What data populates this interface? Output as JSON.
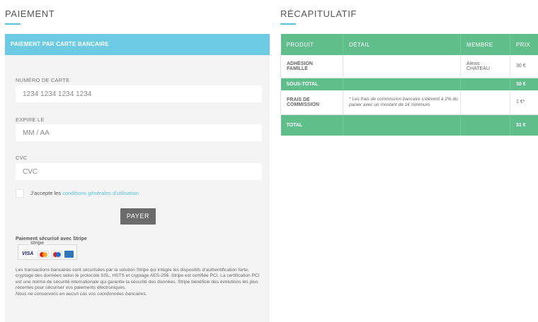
{
  "payment": {
    "title": "PAIEMENT",
    "header": "PAIEMENT PAR CARTE BANCAIRE",
    "card_number_label": "NUMÉRO DE CARTE",
    "card_number_placeholder": "1234 1234 1234 1234",
    "expiry_label": "EXPIRE LE",
    "expiry_placeholder": "MM / AA",
    "cvc_label": "CVC",
    "cvc_placeholder": "CVC",
    "accept_prefix": "J'accepte les",
    "accept_link": "conditions générales d'utilisation",
    "pay_button": "PAYER",
    "secure_title": "Paiement sécurisé avec Stripe",
    "stripe_word": "stripe",
    "visa_label": "VISA",
    "legal_text": "Les transactions bancaires sont sécurisées par la solution Stripe qui intègre les dispositifs d'authentification forte, cryptage des données selon le protocole SSL, HSTS et cryptage AES-256. Stripe est certifiée PCI. La certification PCI est une norme de sécurité internationale qui garantie la sécurité des données. Stripe bénéficie des évolutions les plus récentes pour sécuriser vos paiements électroniques.",
    "legal_italic": "Nous ne conservons en aucun cas vos coordonnées bancaires."
  },
  "summary": {
    "title": "RÉCAPITULATIF",
    "headers": [
      "PRODUIT",
      "DÉTAIL",
      "MEMBRE",
      "PRIX"
    ],
    "item": {
      "product_line1": "ADHÉSION",
      "product_line2": "FAMILLE",
      "detail": "",
      "member_line1": "Alexis",
      "member_line2": "CHATEAU",
      "price": "30 €"
    },
    "subtotal": {
      "label": "SOUS-TOTAL",
      "price": "30 €"
    },
    "fees": {
      "product_line1": "FRAIS DE",
      "product_line2": "COMMISSION",
      "detail": "* Les frais de commission bancaire s'élèvent à 2% du panier avec un montant de 1€ minimum",
      "price": "1 €*"
    },
    "total": {
      "label": "TOTAL",
      "price": "31 €"
    }
  },
  "colors": {
    "accent_blue": "#6ccbe3",
    "accent_green": "#5fbe8a",
    "button_gray": "#6b6b6b"
  }
}
